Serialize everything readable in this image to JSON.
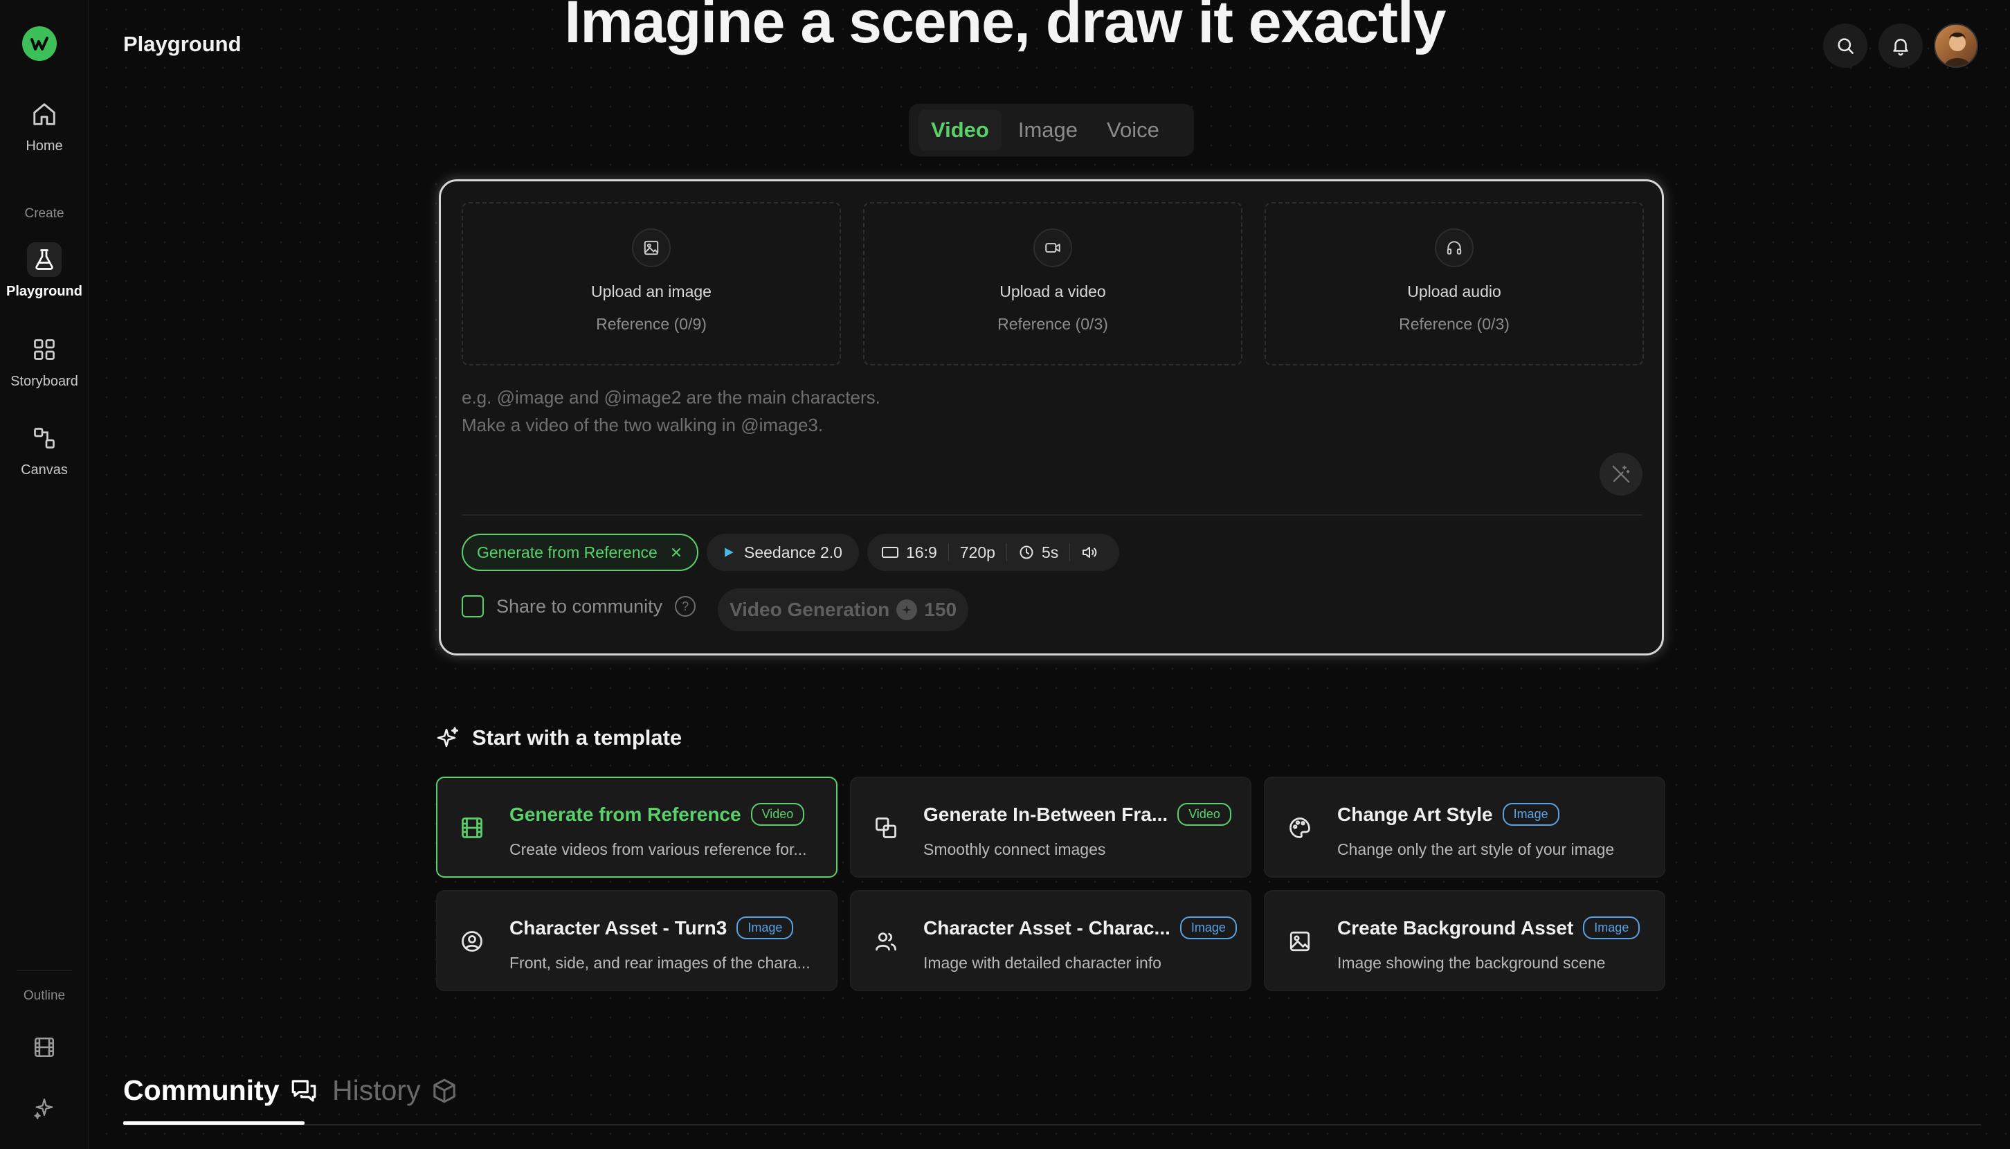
{
  "sidebar": {
    "items": [
      {
        "label": "Home"
      },
      {
        "label": "Playground"
      },
      {
        "label": "Storyboard"
      },
      {
        "label": "Canvas"
      }
    ],
    "section_create": "Create",
    "section_outline": "Outline"
  },
  "header": {
    "page_title": "Playground",
    "hero": "Imagine a scene, draw it exactly"
  },
  "mode_tabs": [
    "Video",
    "Image",
    "Voice"
  ],
  "uploads": [
    {
      "title": "Upload an image",
      "sub": "Reference (0/9)"
    },
    {
      "title": "Upload a video",
      "sub": "Reference (0/3)"
    },
    {
      "title": "Upload audio",
      "sub": "Reference (0/3)"
    }
  ],
  "prompt": {
    "line1": "e.g. @image and @image2 are the main characters.",
    "line2": "Make a video of the two walking in @image3."
  },
  "chips": {
    "reference": "Generate from Reference",
    "model": "Seedance 2.0",
    "ratio": "16:9",
    "resolution": "720p",
    "duration": "5s"
  },
  "share_label": "Share to community",
  "generate": {
    "label": "Video Generation",
    "cost": "150"
  },
  "templates_heading": "Start with a template",
  "templates": [
    {
      "name": "Generate from Reference",
      "badge": "Video",
      "desc": "Create videos from various reference for..."
    },
    {
      "name": "Generate In-Between Fra...",
      "badge": "Video",
      "desc": "Smoothly connect images"
    },
    {
      "name": "Change Art Style",
      "badge": "Image",
      "desc": "Change only the art style of your image"
    },
    {
      "name": "Character Asset - Turn3",
      "badge": "Image",
      "desc": "Front, side, and rear images of the chara..."
    },
    {
      "name": "Character Asset - Charac...",
      "badge": "Image",
      "desc": "Image with detailed character info"
    },
    {
      "name": "Create Background Asset",
      "badge": "Image",
      "desc": "Image showing the background scene"
    }
  ],
  "bottom_tabs": [
    "Community",
    "History"
  ],
  "colors": {
    "accent": "#5ad06b",
    "image_badge": "#5aa2e6",
    "background": "#0b0b0b"
  }
}
